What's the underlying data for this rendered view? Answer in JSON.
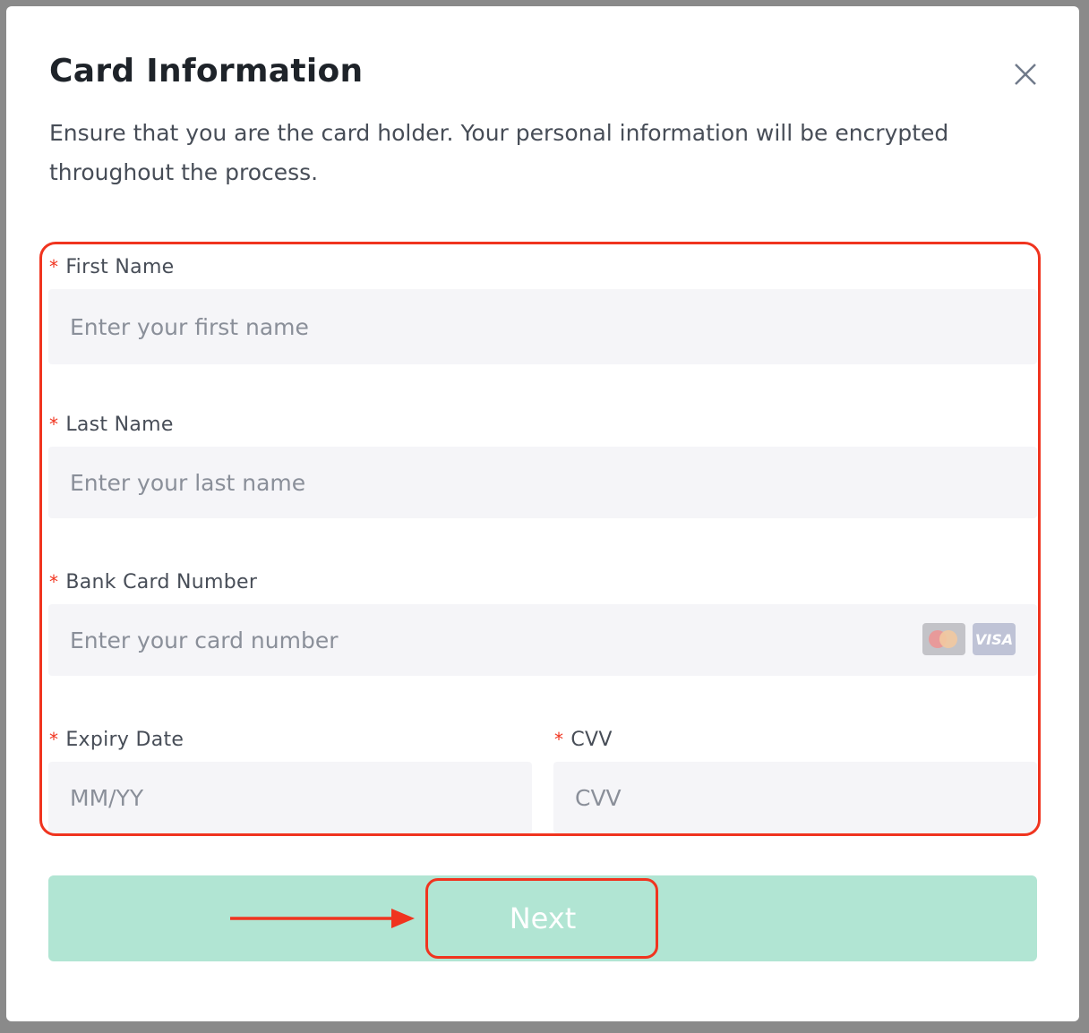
{
  "modal": {
    "title": "Card Information",
    "description": "Ensure that you are the card holder. Your personal information will be encrypted throughout the process."
  },
  "form": {
    "required_marker": "*",
    "first_name": {
      "label": "First Name",
      "placeholder": "Enter your first name"
    },
    "last_name": {
      "label": "Last Name",
      "placeholder": "Enter your last name"
    },
    "card_number": {
      "label": "Bank Card Number",
      "placeholder": "Enter your card number",
      "logos": [
        "mastercard-icon",
        "visa-icon"
      ],
      "visa_text": "VISA"
    },
    "expiry": {
      "label": "Expiry Date",
      "placeholder": "MM/YY"
    },
    "cvv": {
      "label": "CVV",
      "placeholder": "CVV"
    }
  },
  "actions": {
    "next_label": "Next"
  },
  "colors": {
    "accent_disabled": "#b1e5d3",
    "annotation": "#f0341f",
    "input_bg": "#f5f5f8",
    "title": "#1e2329"
  }
}
